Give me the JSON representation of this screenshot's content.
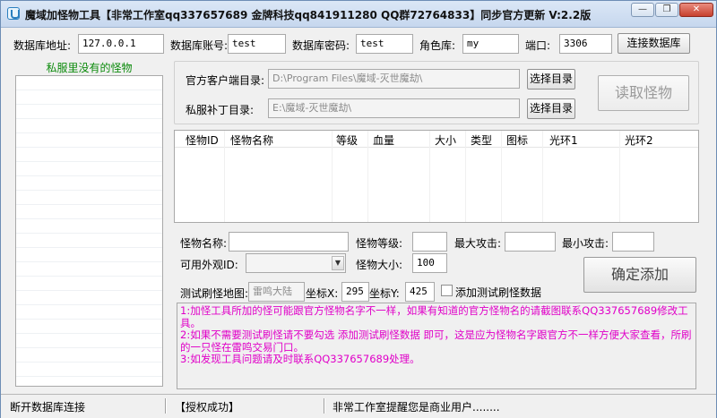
{
  "window": {
    "title": "魔域加怪物工具【非常工作室qq337657689 金牌科技qq841911280 QQ群72764833】同步官方更新 V:2.2版",
    "minimize_glyph": "—",
    "restore_glyph": "❐",
    "close_glyph": "✕"
  },
  "db": {
    "address_label": "数据库地址:",
    "address_value": "127.0.0.1",
    "account_label": "数据库账号:",
    "account_value": "test",
    "password_label": "数据库密码:",
    "password_value": "test",
    "role_db_label": "角色库:",
    "role_db_value": "my",
    "port_label": "端口:",
    "port_value": "3306",
    "connect_button": "连接数据库"
  },
  "left_panel": {
    "title": "私服里没有的怪物"
  },
  "dirs": {
    "official_label": "官方客户端目录:",
    "official_value": "D:\\Program Files\\魔域-灭世魔劫\\",
    "official_button": "选择目录",
    "patch_label": "私服补丁目录:",
    "patch_value": "E:\\魔域-灭世魔劫\\",
    "patch_button": "选择目录",
    "read_button": "读取怪物"
  },
  "table": {
    "columns": [
      "怪物ID",
      "怪物名称",
      "等级",
      "血量",
      "大小",
      "类型",
      "图标",
      "光环1",
      "光环2"
    ]
  },
  "form": {
    "name_label": "怪物名称:",
    "name_value": "",
    "level_label": "怪物等级:",
    "level_value": "",
    "max_attack_label": "最大攻击:",
    "max_attack_value": "",
    "min_attack_label": "最小攻击:",
    "min_attack_value": "",
    "look_id_label": "可用外观ID:",
    "look_id_value": "",
    "size_label": "怪物大小:",
    "size_value": "100",
    "test_map_label": "测试刷怪地图:",
    "test_map_value": "雷鸣大陆",
    "coord_x_label": "坐标X:",
    "coord_x_value": "295",
    "coord_y_label": "坐标Y:",
    "coord_y_value": "425",
    "test_checkbox_label": "添加测试刷怪数据",
    "confirm_button": "确定添加"
  },
  "notes": {
    "line1": "1:加怪工具所加的怪可能跟官方怪物名字不一样，如果有知道的官方怪物名的请截图联系QQ337657689修改工具。",
    "line2": "2:如果不需要测试刷怪请不要勾选 添加测试刷怪数据 即可，这是应为怪物名字跟官方不一样方便大家查看，所刷的一只怪在雷鸣交易门口。",
    "line3": "3:如发现工具问题请及时联系QQ337657689处理。",
    "color": "#e000c8"
  },
  "status": {
    "seg1": "断开数据库连接",
    "seg2": "【授权成功】",
    "seg3": "非常工作室提醒您是商业用户........"
  }
}
